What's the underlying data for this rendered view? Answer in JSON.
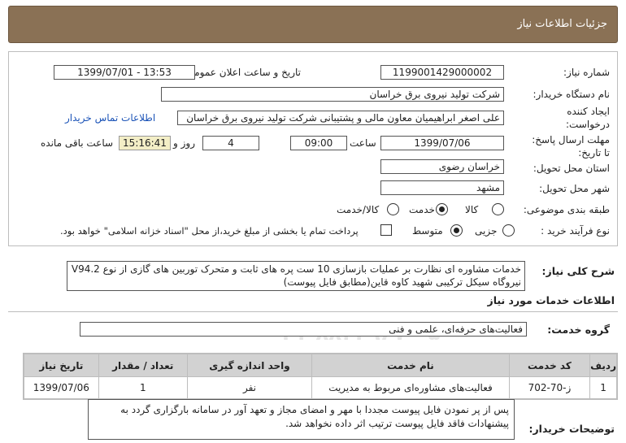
{
  "header": {
    "title": "جزئیات اطلاعات نیاز"
  },
  "fields": {
    "need_number_label": "شماره نیاز:",
    "need_number": "1199001429000002",
    "announce_label": "تاریخ و ساعت اعلان عمومی:",
    "announce_value": "1399/07/01 - 13:53",
    "buyer_label": "نام دستگاه خریدار:",
    "buyer_value": "شرکت تولید نیروی برق خراسان",
    "creator_label_1": "ایجاد کننده",
    "creator_label_2": "درخواست:",
    "creator_value": "علی اصغر ابراهیمیان معاون مالی و پشتیبانی شرکت تولید نیروی برق خراسان",
    "contact_link": "اطلاعات تماس خریدار",
    "deadline_label_1": "مهلت ارسال پاسخ:",
    "deadline_label_2": "تا تاریخ:",
    "deadline_date": "1399/07/06",
    "time_label": "ساعت",
    "deadline_time": "09:00",
    "days_value": "4",
    "days_label": "روز و",
    "remaining_time": "15:16:41",
    "remaining_label": "ساعت باقی مانده",
    "province_label": "استان محل تحویل:",
    "province_value": "خراسان رضوی",
    "city_label": "شهر محل تحویل:",
    "city_value": "مشهد",
    "category_label": "طبقه بندی موضوعی:",
    "category_options": [
      "کالا",
      "خدمت",
      "کالا/خدمت"
    ],
    "category_selected": "خدمت",
    "process_label": "نوع فرآیند خرید :",
    "process_options": [
      "جزیی",
      "متوسط"
    ],
    "process_selected": "متوسط",
    "payment_note": "پرداخت تمام یا بخشی از مبلغ خرید،از محل \"اسناد خزانه اسلامی\" خواهد بود."
  },
  "summary": {
    "label": "شرح کلی نیاز:",
    "text_line1": "خدمات مشاوره ای نظارت بر عملیات بازسازی 10 ست  پره های ثابت و متحرک توربین های گازی از نوع V94.2",
    "text_line2": "نیروگاه سیکل ترکیبی شهید کاوه قاین(مطابق فایل پیوست)"
  },
  "services": {
    "section_title": "اطلاعات خدمات مورد نیاز",
    "group_label": "گروه خدمت:",
    "group_value": "فعالیت‌های حرفه‌ای، علمی و فنی",
    "columns": [
      "ردیف",
      "کد خدمت",
      "نام خدمت",
      "واحد اندازه گیری",
      "تعداد / مقدار",
      "تاریخ نیاز"
    ],
    "rows": [
      [
        "1",
        "ز-70-702",
        "فعالیت‌های مشاوره‌ای مربوط به مدیریت",
        "نفر",
        "1",
        "1399/07/06"
      ]
    ]
  },
  "notes": {
    "label": "توضیحات خریدار:",
    "text": "پس از پر نمودن فایل پیوست مجددا با مهر و امضای مجاز و تعهد آور در سامانه بارگزاری گردد به پیشنهادات فاقد فایل پیوست ترتیب اثر داده نخواهد شد."
  },
  "watermark": {
    "brand": "ParsNamadData",
    "phone": "۰۲۱-۸۸۳۴۹۶۷۰-۵"
  },
  "colors": {
    "header_bg": "#8a7155",
    "link": "#1b53b7",
    "remaining_bg": "#f3eec6",
    "table_header_bg": "#d2d2d2"
  }
}
